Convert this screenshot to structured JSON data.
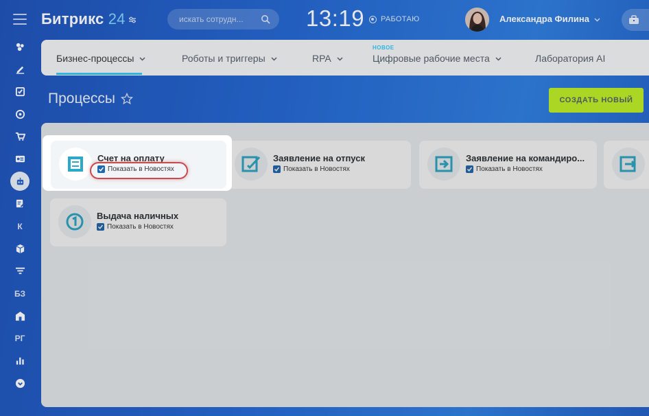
{
  "app": {
    "logo_text": "Битрикс",
    "logo_num": "24"
  },
  "search": {
    "placeholder": "искать сотрудн..."
  },
  "clock": {
    "time": "13:19"
  },
  "status": {
    "label": "РАБОТАЮ"
  },
  "user": {
    "name": "Александра Филина"
  },
  "sidebar": {
    "text_items": [
      "К",
      "БЗ",
      "РГ"
    ]
  },
  "tabs": [
    {
      "label": "Бизнес-процессы"
    },
    {
      "label": "Роботы и триггеры"
    },
    {
      "label": "RPA"
    },
    {
      "label": "Цифровые рабочие места",
      "badge": "НОВОЕ"
    },
    {
      "label": "Лаборатория AI"
    }
  ],
  "page": {
    "title": "Процессы",
    "create_button": "СОЗДАТЬ НОВЫЙ"
  },
  "cards": [
    {
      "title": "Счет на оплату",
      "check_label": "Показать в Новостях",
      "checked": true,
      "icon": "invoice-icon"
    },
    {
      "title": "Заявление на отпуск",
      "check_label": "Показать в Новостях",
      "checked": true,
      "icon": "vacation-request-icon"
    },
    {
      "title": "Заявление на командиро...",
      "check_label": "Показать в Новостях",
      "checked": true,
      "icon": "business-trip-icon"
    },
    {
      "title": "Выдача наличных",
      "check_label": "Показать в Новостях",
      "checked": true,
      "icon": "cash-withdrawal-icon"
    }
  ],
  "colors": {
    "accent_teal": "#2fc6f6",
    "create_button": "#bbed21",
    "checkbox": "#2067b0",
    "highlight_ring": "#c9494f"
  }
}
